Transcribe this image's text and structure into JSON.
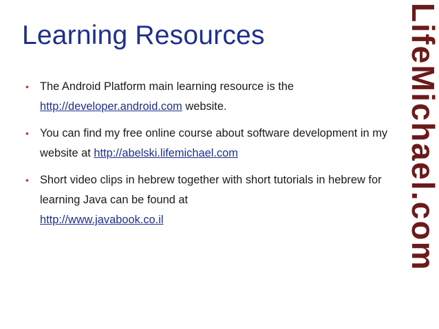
{
  "slide": {
    "title": "Learning Resources",
    "side_brand": "LifeMichael.com",
    "bullet_marker": "•"
  },
  "bullets": [
    {
      "text_before": "The Android Platform main learning resource is the",
      "link": "http://developer.android.com",
      "text_after": " website."
    },
    {
      "text_before": "You can find my free online course about software development in my website at ",
      "link": "http://abelski.lifemichael.com",
      "text_after": ""
    },
    {
      "text_before": "Short video clips in hebrew together with short tutorials in hebrew for learning Java can be found at",
      "link": "http://www.javabook.co.il",
      "text_after": ""
    }
  ],
  "colors": {
    "title": "#1f2f8c",
    "link": "#1f2f8c",
    "bullet_marker": "#c0392b",
    "side_brand": "#6b1a1a"
  }
}
